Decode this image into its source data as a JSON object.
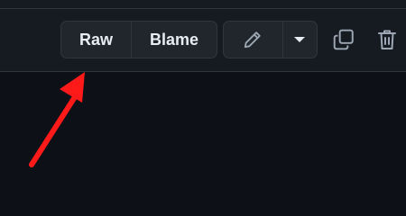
{
  "toolbar": {
    "raw_label": "Raw",
    "blame_label": "Blame",
    "edit_icon": "pencil-icon",
    "dropdown_icon": "caret-down-icon",
    "copy_icon": "copy-icon",
    "delete_icon": "trash-icon"
  },
  "annotation": {
    "arrow_icon": "red-arrow-icon",
    "arrow_color": "#ff1a1a"
  },
  "colors": {
    "background": "#0d1117",
    "toolbar_bg": "#161b22",
    "button_bg": "#21262d",
    "border": "#30363d",
    "text": "#e6edf3",
    "icon": "#9da7b3"
  }
}
